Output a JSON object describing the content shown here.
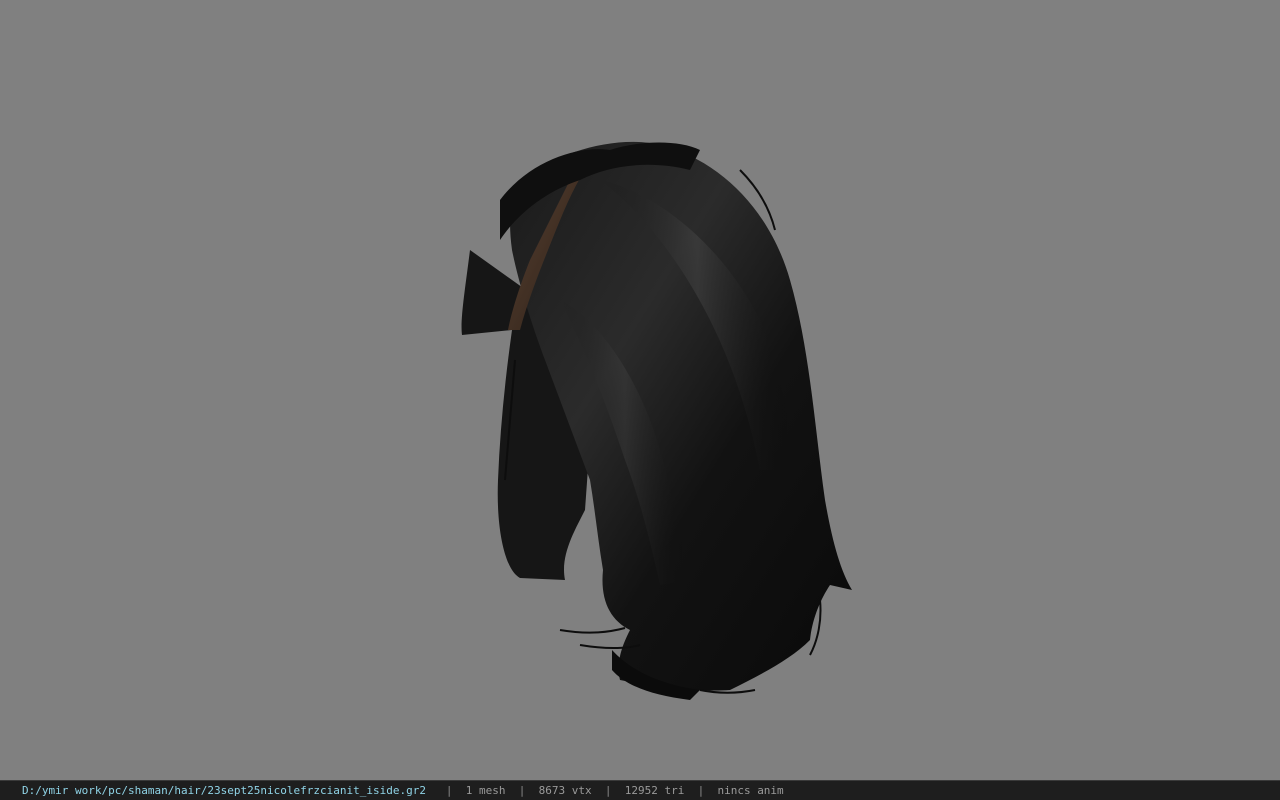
{
  "viewport": {
    "background": "#808080",
    "model_icon": "hair-mesh-preview"
  },
  "status_bar": {
    "file_path": "D:/ymir work/pc/shaman/hair/23sept25nicolefrzcianit_iside.gr2",
    "separator": "|",
    "mesh_count": "1 mesh",
    "vertex_count": "8673 vtx",
    "triangle_count": "12952 tri",
    "animation": "nincs anim",
    "path_color": "#8fd3e6"
  }
}
